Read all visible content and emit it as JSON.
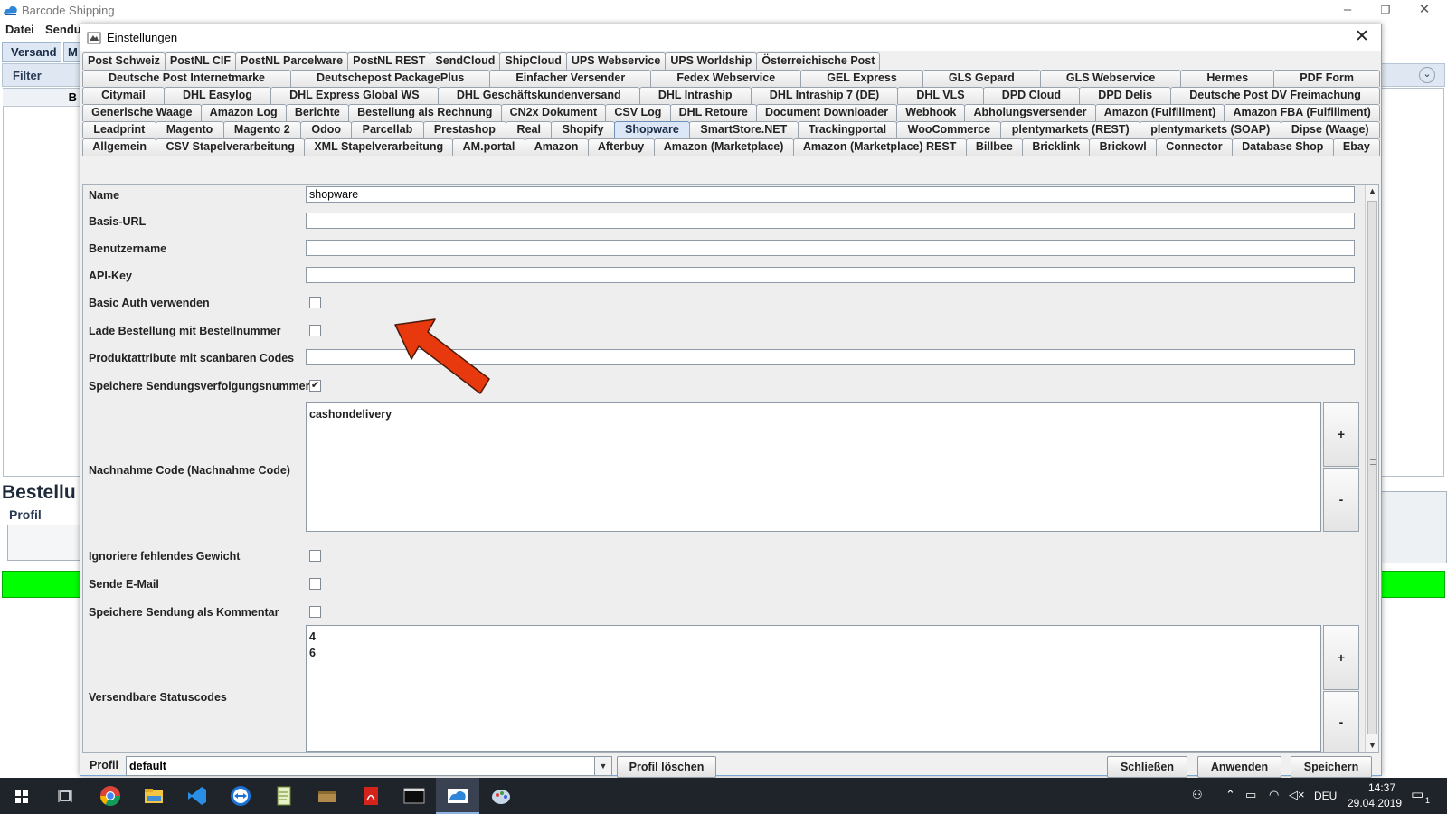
{
  "app": {
    "title": "Barcode Shipping",
    "menu": [
      "Datei",
      "Sendu"
    ],
    "tabs": [
      "Versand",
      "M"
    ],
    "filter_label": "Filter",
    "list_header": "B",
    "section_title": "Bestellu",
    "profil_label": "Profil",
    "status_color": "#00ff00"
  },
  "dialog": {
    "title": "Einstellungen",
    "tab_rows": [
      [
        "Post Schweiz",
        "PostNL CIF",
        "PostNL Parcelware",
        "PostNL REST",
        "SendCloud",
        "ShipCloud",
        "UPS Webservice",
        "UPS Worldship",
        "Österreichische Post"
      ],
      [
        "Deutsche Post Internetmarke",
        "Deutschepost PackagePlus",
        "Einfacher Versender",
        "Fedex Webservice",
        "GEL Express",
        "GLS Gepard",
        "GLS Webservice",
        "Hermes",
        "PDF Form"
      ],
      [
        "Citymail",
        "DHL Easylog",
        "DHL Express Global WS",
        "DHL Geschäftskundenversand",
        "DHL Intraship",
        "DHL Intraship 7 (DE)",
        "DHL VLS",
        "DPD Cloud",
        "DPD Delis",
        "Deutsche Post DV Freimachung"
      ],
      [
        "Generische Waage",
        "Amazon Log",
        "Berichte",
        "Bestellung als Rechnung",
        "CN2x Dokument",
        "CSV Log",
        "DHL Retoure",
        "Document Downloader",
        "Webhook",
        "Abholungsversender",
        "Amazon (Fulfillment)",
        "Amazon FBA (Fulfillment)"
      ],
      [
        "Leadprint",
        "Magento",
        "Magento 2",
        "Odoo",
        "Parcellab",
        "Prestashop",
        "Real",
        "Shopify",
        "Shopware",
        "SmartStore.NET",
        "Trackingportal",
        "WooCommerce",
        "plentymarkets (REST)",
        "plentymarkets (SOAP)",
        "Dipse (Waage)"
      ],
      [
        "Allgemein",
        "CSV Stapelverarbeitung",
        "XML Stapelverarbeitung",
        "AM.portal",
        "Amazon",
        "Afterbuy",
        "Amazon (Marketplace)",
        "Amazon (Marketplace) REST",
        "Billbee",
        "Bricklink",
        "Brickowl",
        "Connector",
        "Database Shop",
        "Ebay"
      ]
    ],
    "selected_tab": "Shopware",
    "fields": {
      "name_label": "Name",
      "name_value": "shopware",
      "basis_url_label": "Basis-URL",
      "basis_url_value": "",
      "benutzername_label": "Benutzername",
      "benutzername_value": "",
      "api_key_label": "API-Key",
      "api_key_value": "",
      "basic_auth_label": "Basic Auth verwenden",
      "basic_auth_checked": false,
      "lade_bestellung_label": "Lade Bestellung mit Bestellnummer",
      "lade_bestellung_checked": false,
      "produktattribute_label": "Produktattribute mit scanbaren Codes",
      "produktattribute_value": "",
      "speichere_tracking_label": "Speichere Sendungsverfolgungsnummer",
      "speichere_tracking_checked": true,
      "nachnahme_label": "Nachnahme Code (Nachnahme Code)",
      "nachnahme_items": [
        "cashondelivery"
      ],
      "ignoriere_gewicht_label": "Ignoriere fehlendes Gewicht",
      "ignoriere_gewicht_checked": false,
      "sende_email_label": "Sende E-Mail",
      "sende_email_checked": false,
      "speichere_kommentar_label": "Speichere Sendung als Kommentar",
      "speichere_kommentar_checked": false,
      "statuscodes_label": "Versendbare Statuscodes",
      "statuscodes_items": [
        "4",
        "6"
      ],
      "add_label": "+",
      "remove_label": "-",
      "check_mark": "✔"
    },
    "footer": {
      "profil_label": "Profil",
      "profil_value": "default",
      "delete_label": "Profil löschen",
      "close_label": "Schließen",
      "apply_label": "Anwenden",
      "save_label": "Speichern"
    },
    "annotation_arrow_color": "#e8380d"
  },
  "taskbar": {
    "icons": [
      "windows-start-icon",
      "task-view-icon",
      "chrome-icon",
      "file-explorer-icon",
      "vscode-icon",
      "teamviewer-icon",
      "notepad-icon",
      "package-icon",
      "acrobat-icon",
      "terminal-icon",
      "barcode-shipping-icon",
      "paint-icon"
    ],
    "language": "DEU",
    "time": "14:37",
    "date": "29.04.2019",
    "notification_count": "1"
  }
}
